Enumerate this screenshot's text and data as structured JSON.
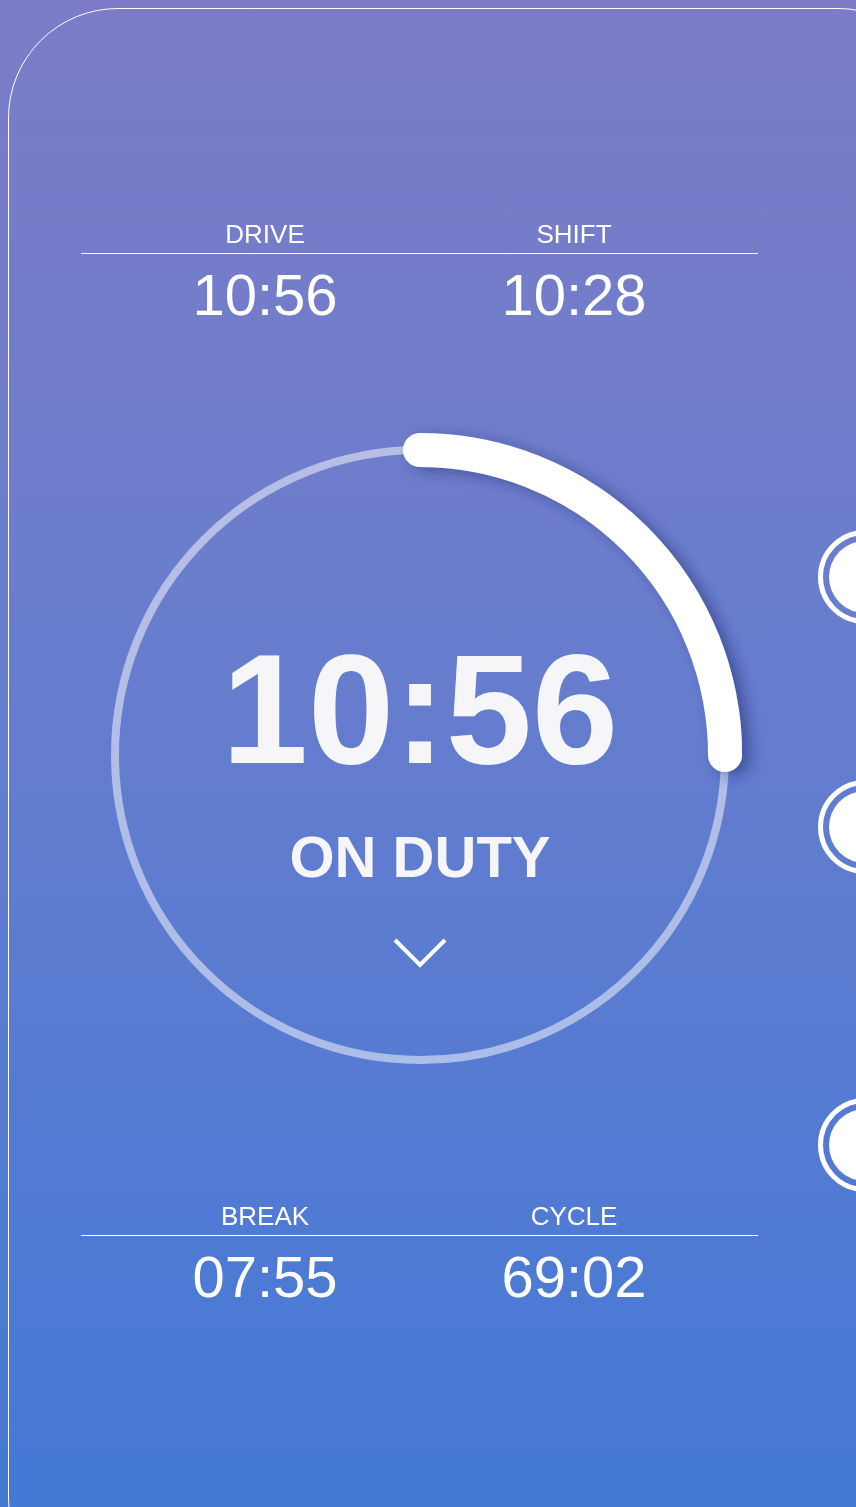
{
  "stats_top": [
    {
      "label": "DRIVE",
      "value": "10:56"
    },
    {
      "label": "SHIFT",
      "value": "10:28"
    }
  ],
  "timer": {
    "time": "10:56",
    "status": "ON DUTY",
    "level": 0.25
  },
  "stats_bottom": [
    {
      "label": "BREAK",
      "value": "07:55"
    },
    {
      "label": "CYCLE",
      "value": "69:02"
    }
  ]
}
